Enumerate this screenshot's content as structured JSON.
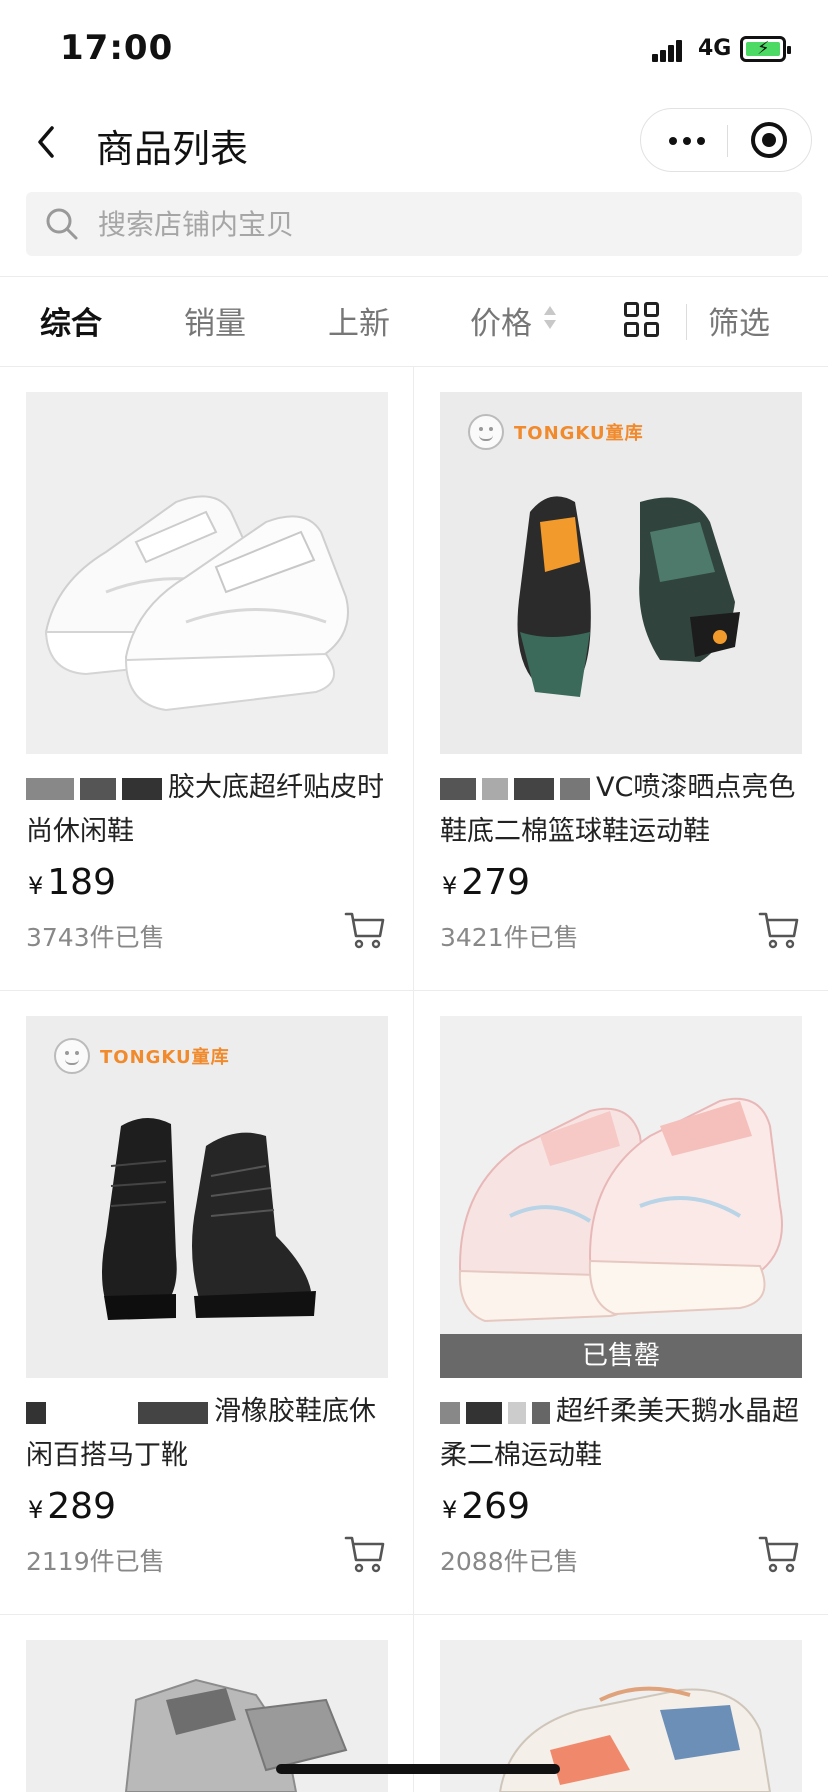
{
  "status_bar": {
    "time": "17:00",
    "network": "4G"
  },
  "nav": {
    "title": "商品列表"
  },
  "search": {
    "placeholder": "搜索店铺内宝贝"
  },
  "sort_tabs": [
    {
      "label": "综合",
      "active": true
    },
    {
      "label": "销量",
      "active": false
    },
    {
      "label": "上新",
      "active": false
    },
    {
      "label": "价格",
      "active": false
    }
  ],
  "filter_label": "筛选",
  "currency_symbol": "¥",
  "brand": "TONGKU童库",
  "products": [
    {
      "title": "胶大底超纤贴皮时尚休闲鞋",
      "price": "189",
      "sold": "3743件已售",
      "image": "white-sneaker",
      "sold_out": false
    },
    {
      "title": "VC喷漆晒点亮色鞋底二棉篮球鞋运动鞋",
      "price": "279",
      "sold": "3421件已售",
      "image": "black-sneaker",
      "sold_out": false
    },
    {
      "title": "滑橡胶鞋底休闲百搭马丁靴",
      "price": "289",
      "sold": "2119件已售",
      "image": "black-boot",
      "sold_out": false
    },
    {
      "title": "超纤柔美天鹅水晶超柔二棉运动鞋",
      "price": "269",
      "sold": "2088件已售",
      "image": "pink-sneaker",
      "sold_out": true,
      "sold_out_label": "已售罄"
    }
  ]
}
